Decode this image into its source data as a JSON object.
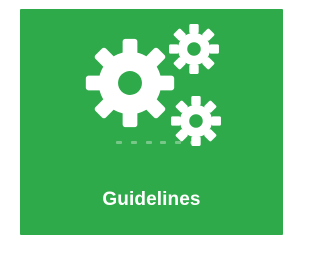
{
  "tile": {
    "label": "Guidelines",
    "background_color": "#2faa4a",
    "foreground_color": "#ffffff",
    "icon": "gears-icon"
  }
}
